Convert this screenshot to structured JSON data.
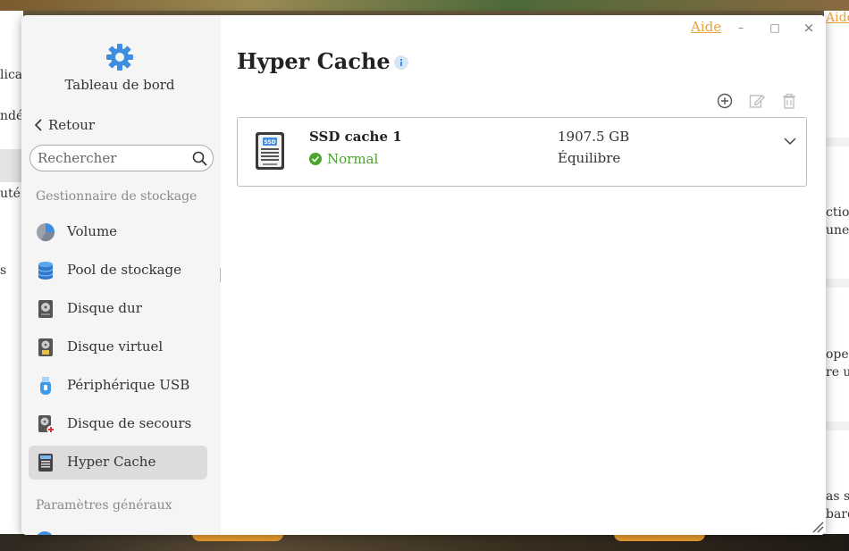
{
  "window": {
    "help_label": "Aide",
    "minimize_symbol": "–",
    "maximize_symbol": "□",
    "close_symbol": "×"
  },
  "sidebar": {
    "dashboard_label": "Tableau de bord",
    "back_label": "Retour",
    "search_placeholder": "Rechercher",
    "section_storage": "Gestionnaire de stockage",
    "section_general": "Paramètres généraux",
    "items": [
      {
        "label": "Volume",
        "icon": "volume-pie-icon",
        "active": false
      },
      {
        "label": "Pool de stockage",
        "icon": "storage-pool-icon",
        "active": false
      },
      {
        "label": "Disque dur",
        "icon": "hard-disk-icon",
        "active": false
      },
      {
        "label": "Disque virtuel",
        "icon": "virtual-disk-icon",
        "active": false
      },
      {
        "label": "Périphérique USB",
        "icon": "usb-device-icon",
        "active": false
      },
      {
        "label": "Disque de secours",
        "icon": "spare-disk-icon",
        "active": false
      },
      {
        "label": "Hyper Cache",
        "icon": "ssd-cache-icon",
        "active": true
      }
    ]
  },
  "main": {
    "title": "Hyper Cache",
    "toolbar": [
      "add-icon",
      "edit-icon",
      "delete-icon"
    ],
    "cache": {
      "name": "SSD cache 1",
      "status": "Normal",
      "size": "1907.5 GB",
      "mode": "Équilibre",
      "icon_text": "SSD"
    }
  },
  "background": {
    "left_fragments": [
      "lica",
      "ndé",
      "uté",
      "s"
    ],
    "right_fragments": [
      "Aide",
      "ction",
      "une",
      "ope",
      "re u",
      "as s",
      "barc"
    ]
  },
  "colors": {
    "accent": "#e8a23a",
    "status_ok": "#4aa42e",
    "sidebar_bg": "#f5f5f5",
    "active_bg": "#dcdcdc",
    "icon_blue": "#3d8de0"
  }
}
